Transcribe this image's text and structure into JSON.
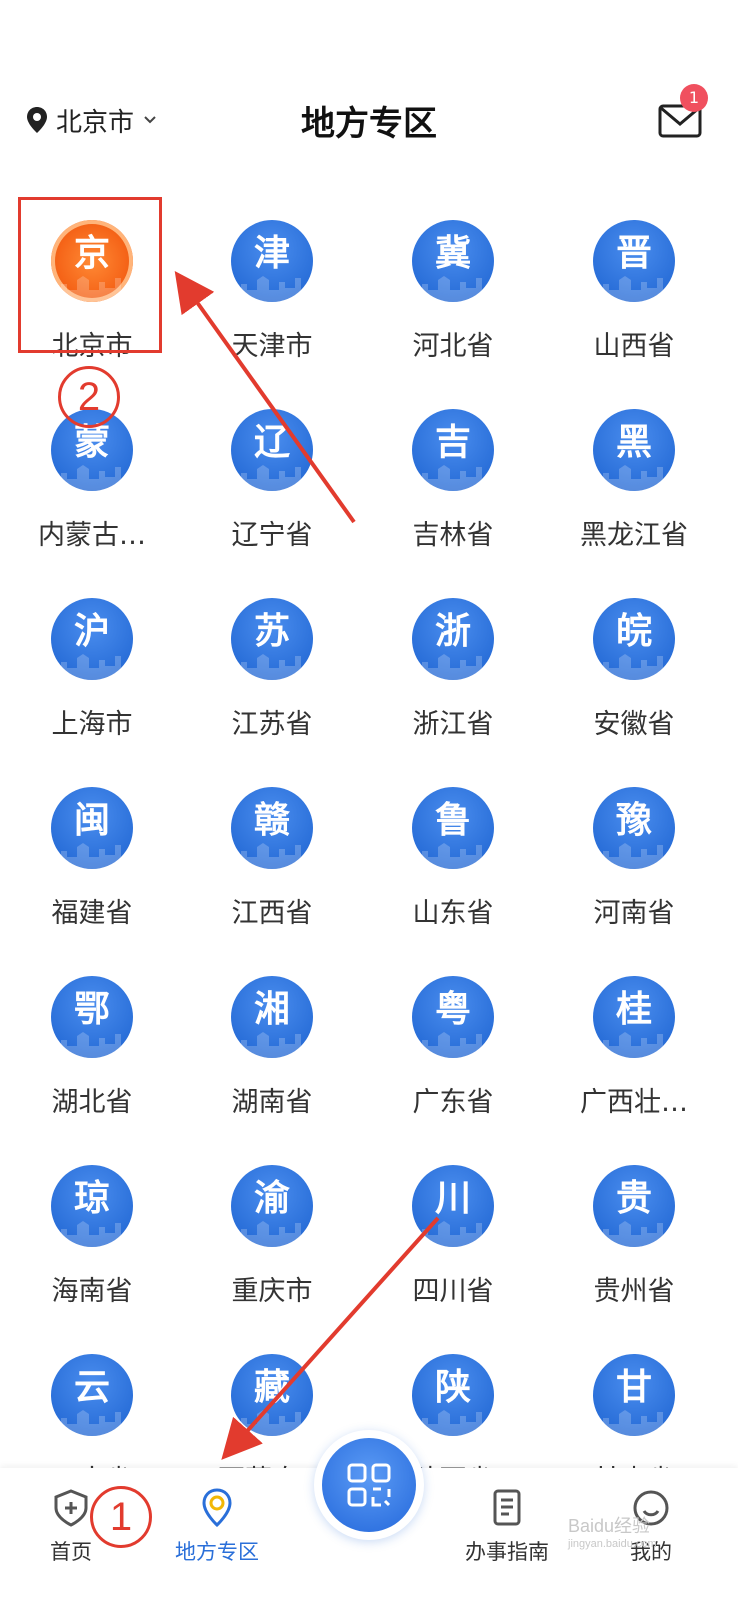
{
  "header": {
    "location": "北京市",
    "title": "地方专区",
    "mail_badge": "1"
  },
  "regions": [
    {
      "glyph": "京",
      "label": "北京市",
      "highlight": true
    },
    {
      "glyph": "津",
      "label": "天津市"
    },
    {
      "glyph": "冀",
      "label": "河北省"
    },
    {
      "glyph": "晋",
      "label": "山西省"
    },
    {
      "glyph": "蒙",
      "label": "内蒙古…"
    },
    {
      "glyph": "辽",
      "label": "辽宁省"
    },
    {
      "glyph": "吉",
      "label": "吉林省"
    },
    {
      "glyph": "黑",
      "label": "黑龙江省"
    },
    {
      "glyph": "沪",
      "label": "上海市"
    },
    {
      "glyph": "苏",
      "label": "江苏省"
    },
    {
      "glyph": "浙",
      "label": "浙江省"
    },
    {
      "glyph": "皖",
      "label": "安徽省"
    },
    {
      "glyph": "闽",
      "label": "福建省"
    },
    {
      "glyph": "赣",
      "label": "江西省"
    },
    {
      "glyph": "鲁",
      "label": "山东省"
    },
    {
      "glyph": "豫",
      "label": "河南省"
    },
    {
      "glyph": "鄂",
      "label": "湖北省"
    },
    {
      "glyph": "湘",
      "label": "湖南省"
    },
    {
      "glyph": "粤",
      "label": "广东省"
    },
    {
      "glyph": "桂",
      "label": "广西壮…"
    },
    {
      "glyph": "琼",
      "label": "海南省"
    },
    {
      "glyph": "渝",
      "label": "重庆市"
    },
    {
      "glyph": "川",
      "label": "四川省"
    },
    {
      "glyph": "贵",
      "label": "贵州省"
    },
    {
      "glyph": "云",
      "label": "云南省"
    },
    {
      "glyph": "藏",
      "label": "西藏自…"
    },
    {
      "glyph": "陕",
      "label": "陕西省"
    },
    {
      "glyph": "甘",
      "label": "甘肃省"
    }
  ],
  "annotations": {
    "step1": "1",
    "step2": "2"
  },
  "tabbar": {
    "home": "首页",
    "regional": "地方专区",
    "guide": "办事指南",
    "mine": "我的"
  },
  "watermark": {
    "main": "Baidu经验",
    "sub": "jingyan.baidu.com"
  },
  "colors": {
    "accent": "#2a6fd9",
    "highlight": "#f56418",
    "annotation": "#e23b2e",
    "badge": "#f0505f"
  }
}
